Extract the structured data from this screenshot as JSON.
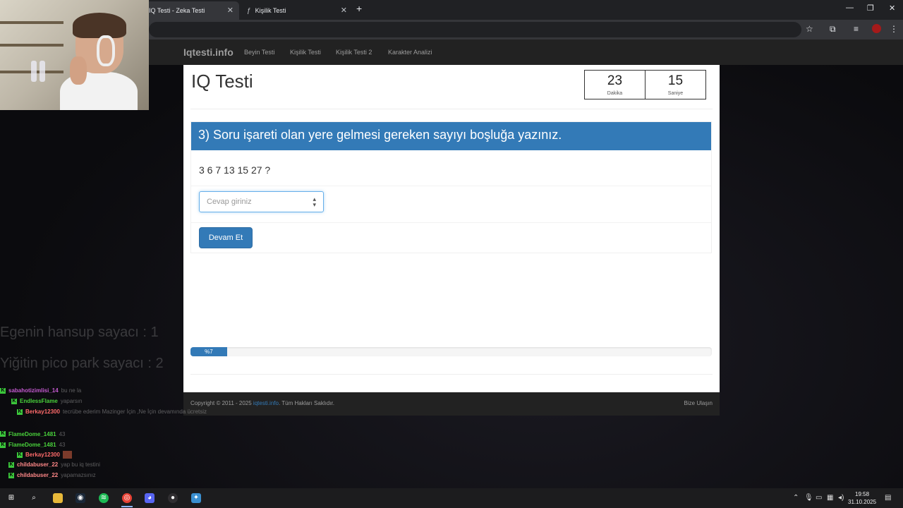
{
  "browser": {
    "tabs": [
      {
        "label": "IQ Testi - Zeka Testi",
        "active": true
      },
      {
        "label": "Kişilik Testi",
        "active": false
      }
    ]
  },
  "navbar": {
    "brand": "Iqtesti.info",
    "links": [
      "Beyin Testi",
      "Kişilik Testi",
      "Kişilik Testi 2",
      "Karakter Analizi"
    ]
  },
  "page": {
    "title": "IQ Testi",
    "timer": {
      "minutes": "23",
      "minutes_label": "Dakika",
      "seconds": "15",
      "seconds_label": "Saniye"
    },
    "question": {
      "heading": "3) Soru işareti olan yere gelmesi gereken sayıyı boşluğa yazınız.",
      "sequence": "3 6 7 13 15 27 ?"
    },
    "answer_placeholder": "Cevap giriniz",
    "continue_label": "Devam Et",
    "progress": {
      "percent": 7,
      "label": "%7"
    }
  },
  "footer": {
    "copyright": "Copyright © 2011 - 2025",
    "site": "iqtesti.info",
    "rights": ". Tüm Hakları Saklıdır.",
    "contact": "Bize Ulaşın"
  },
  "overlay": {
    "line1": "Egenin hansup sayacı : 1",
    "line2": "Yiğitin pico park sayacı : 2"
  },
  "chat": [
    {
      "user": "sabahotizimlisi_14",
      "color": "#c45ad0",
      "msg": "bu ne la",
      "badges": 1,
      "emote": false
    },
    {
      "user": "EndlessFlame",
      "color": "#49d13b",
      "msg": "yaparsın",
      "badges": 2,
      "emote": false
    },
    {
      "user": "Berkay12300",
      "color": "#ff6b6b",
      "msg": "tecrübe ederim Mazinger İçin ,Ne İçin devamında ücretsiz",
      "badges": 3,
      "emote": false
    },
    {
      "user": "FlameDome_1481",
      "color": "#49d13b",
      "msg": "43",
      "badges": 1,
      "emote": false
    },
    {
      "user": "FlameDome_1481",
      "color": "#49d13b",
      "msg": "43",
      "badges": 1,
      "emote": false
    },
    {
      "user": "Berkay12300",
      "color": "#ff6b6b",
      "msg": "",
      "badges": 3,
      "emote": true
    },
    {
      "user": "childabuser_22",
      "color": "#ff8888",
      "msg": "yap bu iq testini",
      "badges": 2,
      "emote": false
    },
    {
      "user": "childabuser_22",
      "color": "#ff8888",
      "msg": "yapamazsınız",
      "badges": 2,
      "emote": false
    }
  ],
  "taskbar": {
    "time": "19:58",
    "date": "31.10.2025"
  },
  "colors": {
    "primary": "#337ab7",
    "navbar": "#222222",
    "chrome_tabbar": "#202124",
    "chrome_toolbar": "#35363a"
  },
  "icons": [
    "windows-start-icon",
    "search-icon",
    "file-explorer-icon",
    "steam-icon",
    "spotify-icon",
    "chrome-icon",
    "discord-icon",
    "obs-icon",
    "app-icon"
  ]
}
